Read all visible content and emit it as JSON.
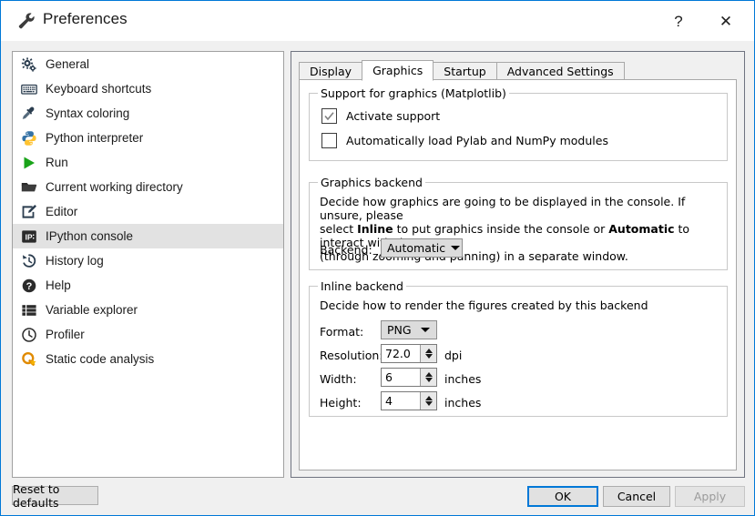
{
  "window": {
    "title": "Preferences",
    "title_icon": "wrench-icon",
    "help_label": "?",
    "close_label": "✕",
    "accent_color": "#0078d7"
  },
  "sidebar": {
    "items": [
      {
        "label": "General",
        "icon": "gears-icon"
      },
      {
        "label": "Keyboard shortcuts",
        "icon": "keyboard-icon"
      },
      {
        "label": "Syntax coloring",
        "icon": "eyedropper-icon"
      },
      {
        "label": "Python interpreter",
        "icon": "python-icon"
      },
      {
        "label": "Run",
        "icon": "play-icon"
      },
      {
        "label": "Current working directory",
        "icon": "folder-icon"
      },
      {
        "label": "Editor",
        "icon": "edit-pencil-icon"
      },
      {
        "label": "IPython console",
        "icon": "ipython-icon",
        "selected": true
      },
      {
        "label": "History log",
        "icon": "history-icon"
      },
      {
        "label": "Help",
        "icon": "question-circle-icon"
      },
      {
        "label": "Variable explorer",
        "icon": "list-icon"
      },
      {
        "label": "Profiler",
        "icon": "clock-icon"
      },
      {
        "label": "Static code analysis",
        "icon": "pylint-q-icon"
      }
    ]
  },
  "tabs": [
    {
      "label": "Display",
      "active": false
    },
    {
      "label": "Graphics",
      "active": true
    },
    {
      "label": "Startup",
      "active": false
    },
    {
      "label": "Advanced Settings",
      "active": false
    }
  ],
  "support_group": {
    "title": "Support for graphics (Matplotlib)",
    "checkboxes": [
      {
        "label": "Activate support",
        "checked": true
      },
      {
        "label": "Automatically load Pylab and NumPy modules",
        "checked": false
      }
    ]
  },
  "backend_group": {
    "title": "Graphics backend",
    "description_line1": "Decide how graphics are going to be displayed in the console. If unsure, please",
    "description_line2_pre": "select ",
    "description_line2_bold1": "Inline",
    "description_line2_mid": " to put graphics inside the console or ",
    "description_line2_bold2": "Automatic",
    "description_line2_post": " to interact with them",
    "description_line3": "(through zooming and panning) in a separate window.",
    "backend_label": "Backend:",
    "backend_value": "Automatic"
  },
  "inline_group": {
    "title": "Inline backend",
    "description": "Decide how to render the figures created by this backend",
    "format_label": "Format:",
    "format_value": "PNG",
    "resolution_label": "Resolution:",
    "resolution_value": "72.0",
    "resolution_unit": "dpi",
    "width_label": "Width:",
    "width_value": "6",
    "width_unit": "inches",
    "height_label": "Height:",
    "height_value": "4",
    "height_unit": "inches"
  },
  "footer": {
    "reset_label": "Reset to defaults",
    "ok_label": "OK",
    "cancel_label": "Cancel",
    "apply_label": "Apply",
    "apply_disabled": true
  }
}
